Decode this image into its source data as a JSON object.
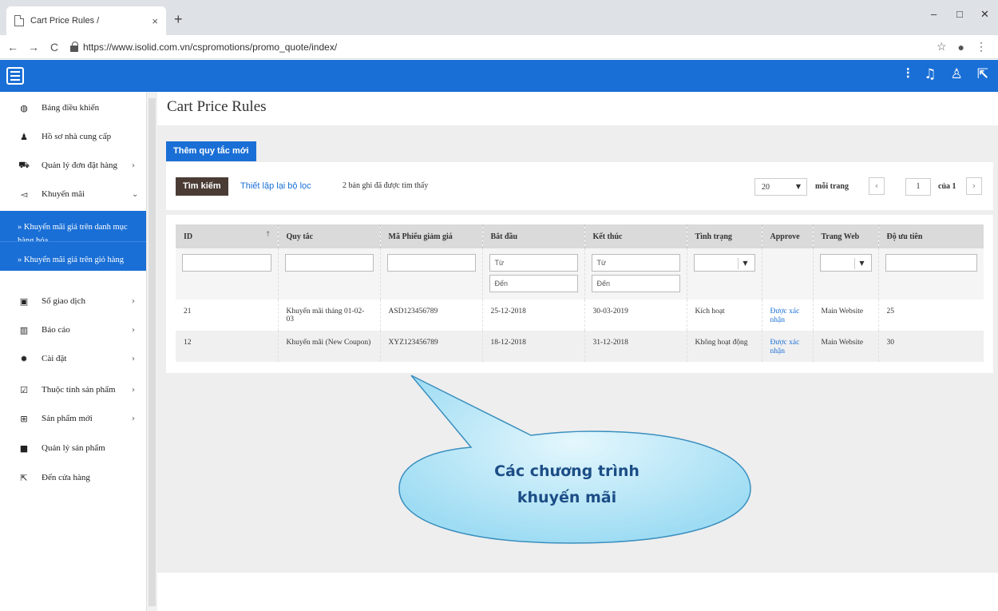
{
  "browser": {
    "tab_title": "Cart Price Rules /",
    "tab_close": "×",
    "new_tab": "+",
    "url": "https://www.isolid.com.vn/cspromotions/promo_quote/index/",
    "back": "←",
    "forward": "→",
    "reload": "C",
    "star": "☆",
    "profile": "●",
    "menu": "⋮",
    "minimize": "–",
    "maximize": "□",
    "close": "✕"
  },
  "header": {
    "icons": [
      "sliders-icon",
      "bell-icon",
      "user-icon",
      "external-link-icon"
    ],
    "icon_glyphs": [
      "⫶",
      "♫",
      "♙",
      "⇱"
    ]
  },
  "sidebar": {
    "items": [
      {
        "icon": "dashboard-icon",
        "glyph": "◍",
        "label": "Bảng điều khiển",
        "chevron": ""
      },
      {
        "icon": "user-icon",
        "glyph": "♟",
        "label": "Hồ sơ nhà cung cấp",
        "chevron": ""
      },
      {
        "icon": "cart-icon",
        "glyph": "⛟",
        "label": "Quản lý đơn đặt hàng",
        "chevron": "›"
      },
      {
        "icon": "megaphone-icon",
        "glyph": "◅",
        "label": "Khuyến mãi",
        "chevron": "⌄"
      },
      {
        "icon": "ledger-icon",
        "glyph": "▣",
        "label": "Sổ giao dịch",
        "chevron": "›"
      },
      {
        "icon": "bar-chart-icon",
        "glyph": "▥",
        "label": "Báo cáo",
        "chevron": "›"
      },
      {
        "icon": "gear-icon",
        "glyph": "✹",
        "label": "Cài đặt",
        "chevron": "›"
      },
      {
        "icon": "checkbox-icon",
        "glyph": "☑",
        "label": "Thuộc tính sản phẩm",
        "chevron": "›"
      },
      {
        "icon": "plus-square-icon",
        "glyph": "⊞",
        "label": "Sản phẩm mới",
        "chevron": "›"
      },
      {
        "icon": "folder-icon",
        "glyph": "■",
        "label": "Quản lý sản phẩm",
        "chevron": ""
      },
      {
        "icon": "external-link-icon",
        "glyph": "⇱",
        "label": "Đến cửa hàng",
        "chevron": ""
      }
    ],
    "submenu": [
      "»   Khuyến mãi giá trên danh mục hàng hóa",
      "»   Khuyến mãi giá trên giỏ hàng"
    ]
  },
  "main": {
    "title": "Cart Price Rules",
    "add_button": "Thêm quy tắc mới",
    "search_button": "Tìm kiếm",
    "reset_filter": "Thiết lập lại bộ lọc",
    "records_found": "2 bản ghi đã được tìm thấy",
    "per_page_value": "20",
    "per_page_label": "mỗi trang",
    "page_prev": "‹",
    "page_next": "›",
    "page_current": "1",
    "page_of": "của 1"
  },
  "grid": {
    "columns": [
      "ID",
      "Quy tắc",
      "Mã Phiếu giảm giá",
      "Bắt đầu",
      "Kết thúc",
      "Tình trạng",
      "Approve",
      "Trang Web",
      "Độ ưu tiên"
    ],
    "sort_indicator": "↑",
    "filter_from": "Từ",
    "filter_to": "Đến",
    "rows": [
      [
        "21",
        "Khuyến mãi tháng 01-02-03",
        "ASD123456789",
        "25-12-2018",
        "30-03-2019",
        "Kích hoạt",
        "Được xác nhận",
        "Main Website",
        "25"
      ],
      [
        "12",
        "Khuyến mãi (New Coupon)",
        "XYZ123456789",
        "18-12-2018",
        "31-12-2018",
        "Không hoạt động",
        "Được xác nhận",
        "Main Website",
        "30"
      ]
    ]
  },
  "callout": {
    "line1": "Các chương trình",
    "line2": "khuyến mãi"
  },
  "colors": {
    "brand": "#1a6fd6",
    "search_button": "#4a3c35",
    "callout_fill": "#b8e8f8"
  }
}
